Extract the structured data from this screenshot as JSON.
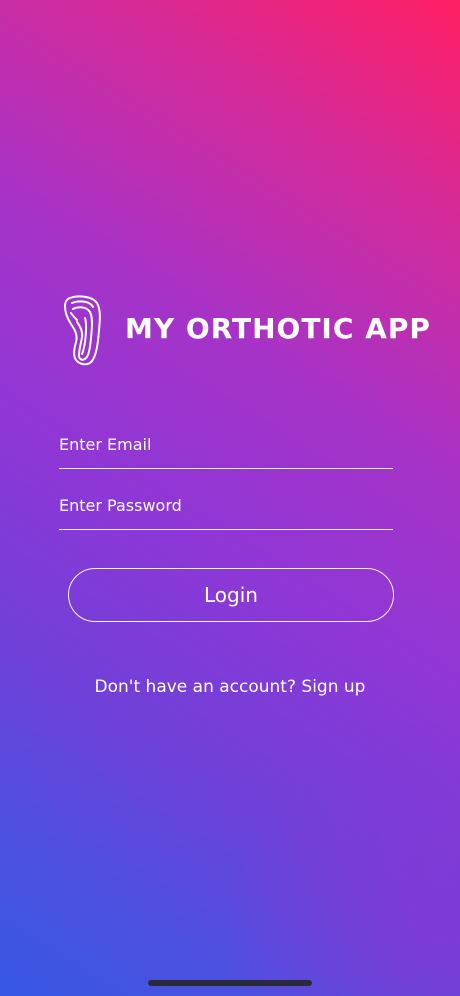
{
  "brand": {
    "app_name": "MY ORTHOTIC APP",
    "logo_icon": "foot-insole-icon"
  },
  "login_form": {
    "email_placeholder": "Enter Email",
    "email_value": "",
    "password_placeholder": "Enter Password",
    "password_value": "",
    "login_label": "Login"
  },
  "signup": {
    "prompt": "Don't have an account?",
    "link_label": "Sign up"
  },
  "colors": {
    "gradient_top_right": "#ff1f63",
    "gradient_middle": "#8e37d6",
    "gradient_bottom_left": "#3658e3",
    "foreground": "#ffffff"
  }
}
